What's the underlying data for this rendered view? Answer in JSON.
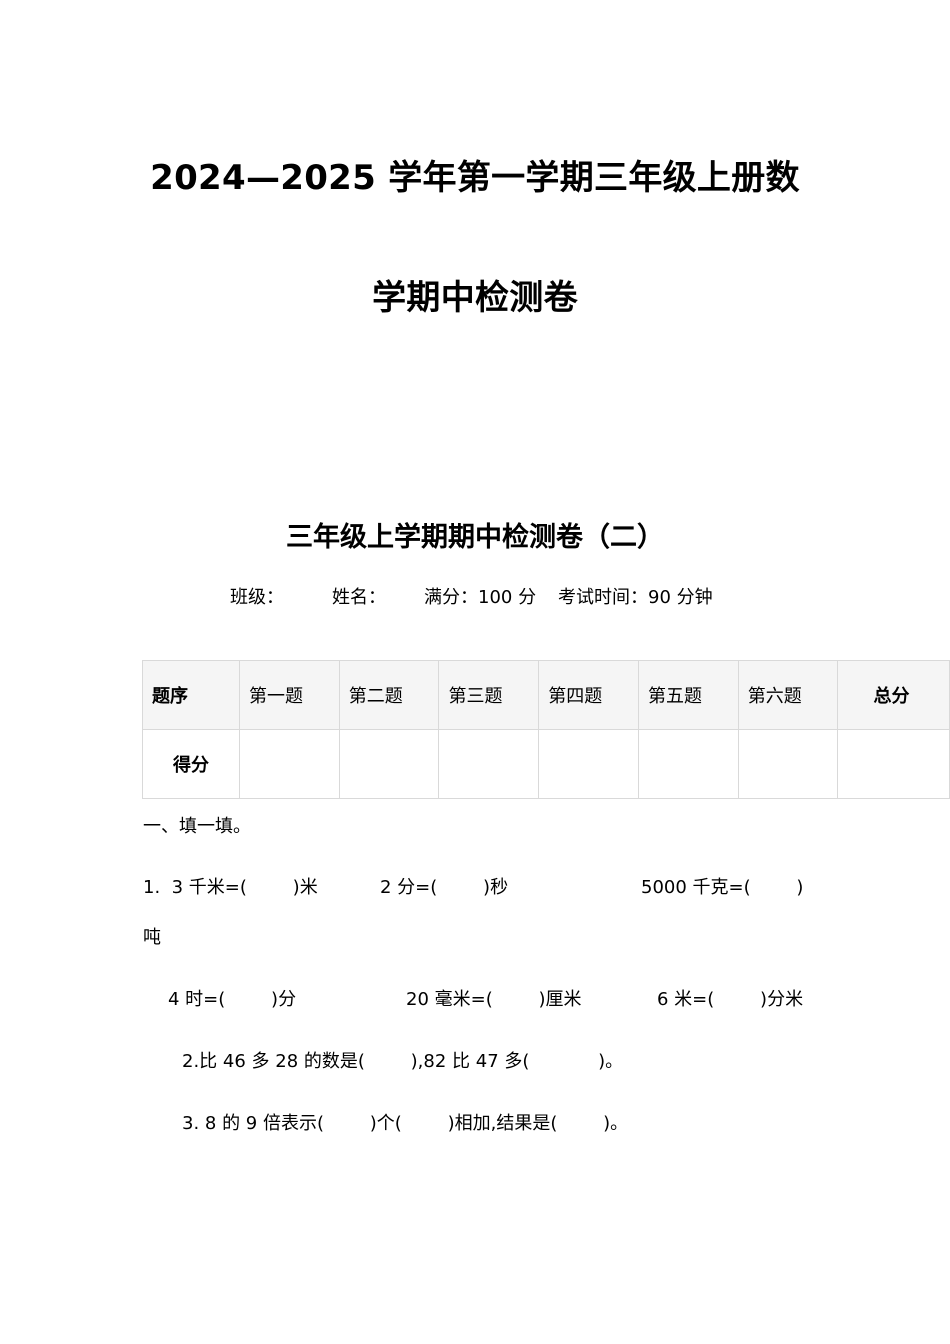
{
  "header": {
    "title_line_1": "2024—2025 学年第一学期三年级上册数",
    "title_line_2": "学期中检测卷"
  },
  "exam": {
    "subtitle": "三年级上学期期中检测卷（二）",
    "class_label": "班级：",
    "name_label": "姓名：",
    "full_score": "满分：100 分",
    "exam_time": "考试时间：90 分钟"
  },
  "score_table": {
    "row_header_label": "题序",
    "columns": [
      "第一题",
      "第二题",
      "第三题",
      "第四题",
      "第五题",
      "第六题"
    ],
    "total_label": "总分",
    "score_row_label": "得分"
  },
  "section1": {
    "heading": "一、填一填。",
    "q1": {
      "a": "1.  3 千米=(        )米",
      "b": "2 分=(        )秒",
      "c": "5000 千克=(        )",
      "c_unit": "吨",
      "d": "4 时=(        )分",
      "e": "20 毫米=(        )厘米",
      "f": "6 米=(        )分米"
    },
    "q2": "2.比 46 多 28 的数是(        ),82 比 47 多(            )。",
    "q3": "3. 8 的 9 倍表示(        )个(        )相加,结果是(        )。"
  }
}
